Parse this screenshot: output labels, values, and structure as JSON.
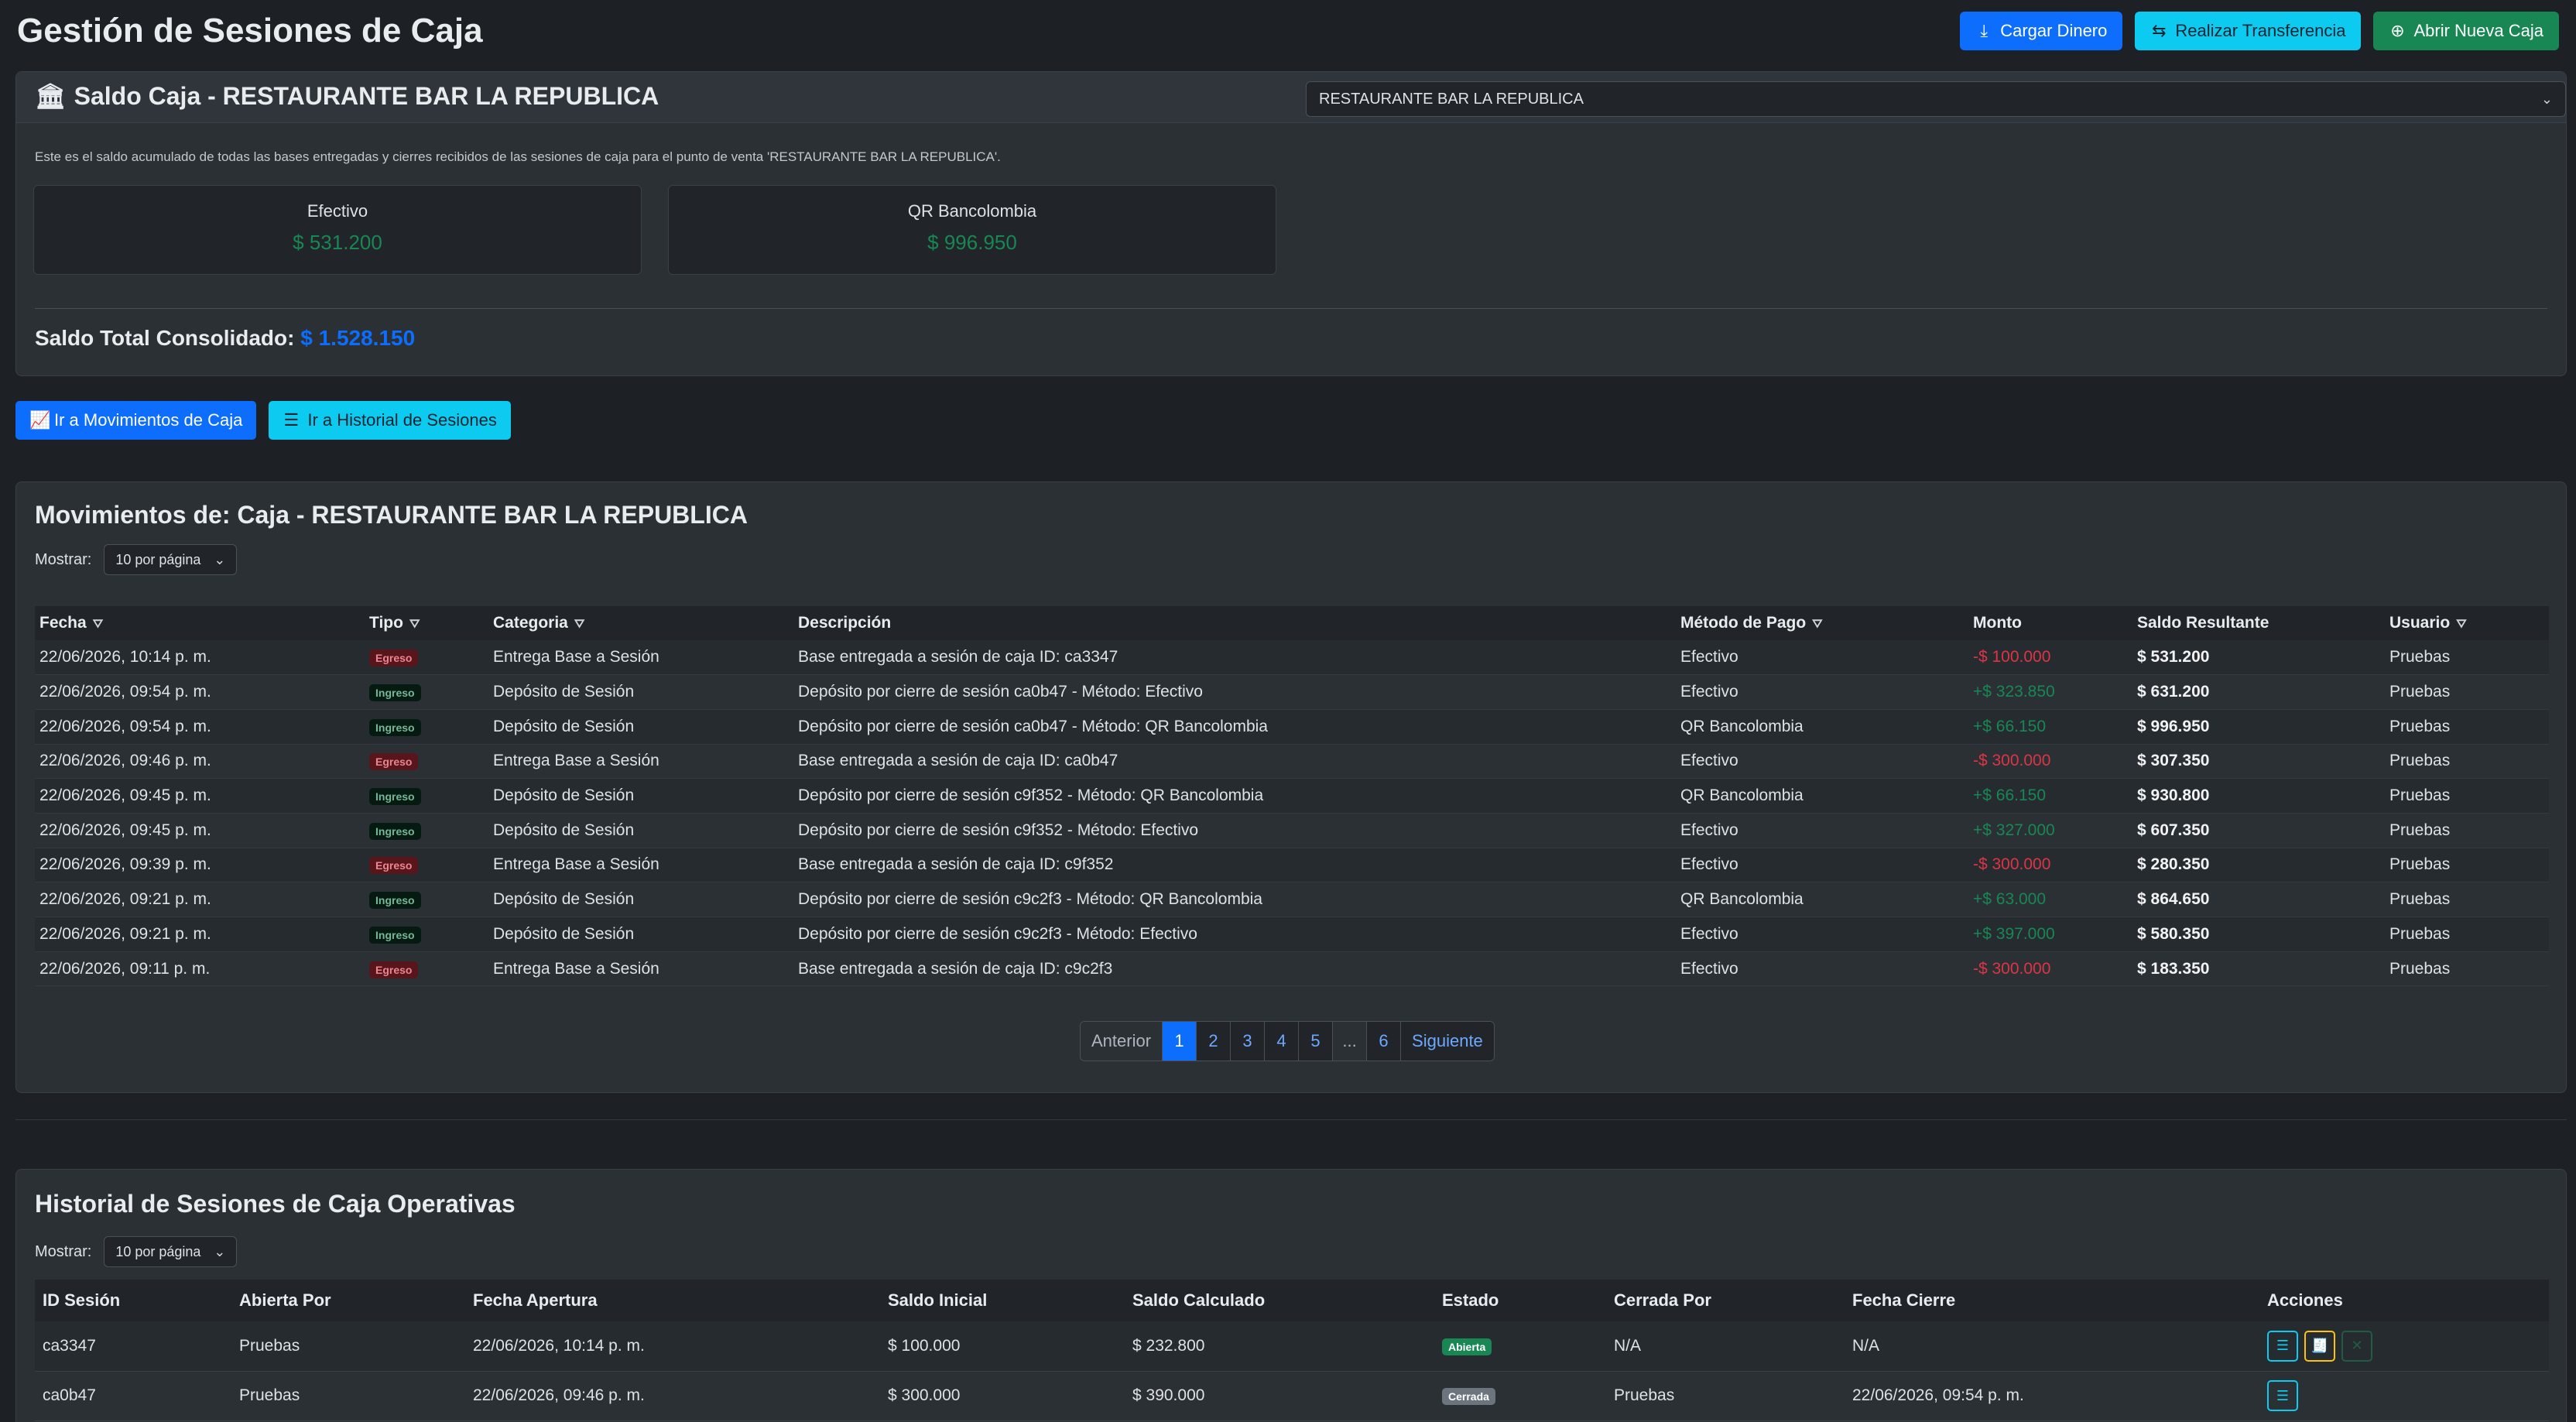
{
  "header": {
    "title": "Gestión de Sesiones de Caja",
    "actions": [
      {
        "label": "Cargar Dinero",
        "icon": "download-icon"
      },
      {
        "label": "Realizar Transferencia",
        "icon": "arrows-exchange-icon"
      },
      {
        "label": "Abrir Nueva Caja",
        "icon": "plus-circle-icon"
      }
    ]
  },
  "saldo": {
    "title": "Saldo Caja - RESTAURANTE BAR LA REPUBLICA",
    "selected_point": "RESTAURANTE BAR LA REPUBLICA",
    "description": "Este es el saldo acumulado de todas las bases entregadas y cierres recibidos de las sesiones de caja para el punto de venta 'RESTAURANTE BAR LA REPUBLICA'.",
    "metrics": [
      {
        "label": "Efectivo",
        "value": "$ 531.200"
      },
      {
        "label": "QR Bancolombia",
        "value": "$ 996.950"
      }
    ],
    "total_label": "Saldo Total Consolidado:",
    "total_value": "$ 1.528.150"
  },
  "nav": {
    "movimientos": "Ir a Movimientos de Caja",
    "historial": "Ir a Historial de Sesiones"
  },
  "movimientos": {
    "title": "Movimientos de: Caja - RESTAURANTE BAR LA REPUBLICA",
    "mostrar_label": "Mostrar:",
    "per_page": "10 por página",
    "columns": [
      "Fecha",
      "Tipo",
      "Categoria",
      "Descripción",
      "Método de Pago",
      "Monto",
      "Saldo Resultante",
      "Usuario"
    ],
    "rows": [
      {
        "fecha": "22/06/2026, 10:14 p. m.",
        "tipo": "Egreso",
        "categoria": "Entrega Base a Sesión",
        "descripcion": "Base entregada a sesión de caja ID: ca3347",
        "metodo": "Efectivo",
        "monto": "-$ 100.000",
        "saldo": "$ 531.200",
        "usuario": "Pruebas"
      },
      {
        "fecha": "22/06/2026, 09:54 p. m.",
        "tipo": "Ingreso",
        "categoria": "Depósito de Sesión",
        "descripcion": "Depósito por cierre de sesión ca0b47 - Método: Efectivo",
        "metodo": "Efectivo",
        "monto": "+$ 323.850",
        "saldo": "$ 631.200",
        "usuario": "Pruebas"
      },
      {
        "fecha": "22/06/2026, 09:54 p. m.",
        "tipo": "Ingreso",
        "categoria": "Depósito de Sesión",
        "descripcion": "Depósito por cierre de sesión ca0b47 - Método: QR Bancolombia",
        "metodo": "QR Bancolombia",
        "monto": "+$ 66.150",
        "saldo": "$ 996.950",
        "usuario": "Pruebas"
      },
      {
        "fecha": "22/06/2026, 09:46 p. m.",
        "tipo": "Egreso",
        "categoria": "Entrega Base a Sesión",
        "descripcion": "Base entregada a sesión de caja ID: ca0b47",
        "metodo": "Efectivo",
        "monto": "-$ 300.000",
        "saldo": "$ 307.350",
        "usuario": "Pruebas"
      },
      {
        "fecha": "22/06/2026, 09:45 p. m.",
        "tipo": "Ingreso",
        "categoria": "Depósito de Sesión",
        "descripcion": "Depósito por cierre de sesión c9f352 - Método: QR Bancolombia",
        "metodo": "QR Bancolombia",
        "monto": "+$ 66.150",
        "saldo": "$ 930.800",
        "usuario": "Pruebas"
      },
      {
        "fecha": "22/06/2026, 09:45 p. m.",
        "tipo": "Ingreso",
        "categoria": "Depósito de Sesión",
        "descripcion": "Depósito por cierre de sesión c9f352 - Método: Efectivo",
        "metodo": "Efectivo",
        "monto": "+$ 327.000",
        "saldo": "$ 607.350",
        "usuario": "Pruebas"
      },
      {
        "fecha": "22/06/2026, 09:39 p. m.",
        "tipo": "Egreso",
        "categoria": "Entrega Base a Sesión",
        "descripcion": "Base entregada a sesión de caja ID: c9f352",
        "metodo": "Efectivo",
        "monto": "-$ 300.000",
        "saldo": "$ 280.350",
        "usuario": "Pruebas"
      },
      {
        "fecha": "22/06/2026, 09:21 p. m.",
        "tipo": "Ingreso",
        "categoria": "Depósito de Sesión",
        "descripcion": "Depósito por cierre de sesión c9c2f3 - Método: QR Bancolombia",
        "metodo": "QR Bancolombia",
        "monto": "+$ 63.000",
        "saldo": "$ 864.650",
        "usuario": "Pruebas"
      },
      {
        "fecha": "22/06/2026, 09:21 p. m.",
        "tipo": "Ingreso",
        "categoria": "Depósito de Sesión",
        "descripcion": "Depósito por cierre de sesión c9c2f3 - Método: Efectivo",
        "metodo": "Efectivo",
        "monto": "+$ 397.000",
        "saldo": "$ 580.350",
        "usuario": "Pruebas"
      },
      {
        "fecha": "22/06/2026, 09:11 p. m.",
        "tipo": "Egreso",
        "categoria": "Entrega Base a Sesión",
        "descripcion": "Base entregada a sesión de caja ID: c9c2f3",
        "metodo": "Efectivo",
        "monto": "-$ 300.000",
        "saldo": "$ 183.350",
        "usuario": "Pruebas"
      }
    ],
    "pagination": {
      "prev": "Anterior",
      "pages": [
        "1",
        "2",
        "3",
        "4",
        "5",
        "...",
        "6"
      ],
      "active": "1",
      "next": "Siguiente"
    }
  },
  "historial": {
    "title": "Historial de Sesiones de Caja Operativas",
    "mostrar_label": "Mostrar:",
    "per_page": "10 por página",
    "columns": [
      "ID Sesión",
      "Abierta Por",
      "Fecha Apertura",
      "Saldo Inicial",
      "Saldo Calculado",
      "Estado",
      "Cerrada Por",
      "Fecha Cierre",
      "Acciones"
    ],
    "rows": [
      {
        "id": "ca3347",
        "abierta_por": "Pruebas",
        "fecha_apertura": "22/06/2026, 10:14 p. m.",
        "saldo_inicial": "$ 100.000",
        "saldo_calculado": "$ 232.800",
        "estado": "Abierta",
        "cerrada_por": "N/A",
        "fecha_cierre": "N/A"
      },
      {
        "id": "ca0b47",
        "abierta_por": "Pruebas",
        "fecha_apertura": "22/06/2026, 09:46 p. m.",
        "saldo_inicial": "$ 300.000",
        "saldo_calculado": "$ 390.000",
        "estado": "Cerrada",
        "cerrada_por": "Pruebas",
        "fecha_cierre": "22/06/2026, 09:54 p. m."
      }
    ]
  }
}
